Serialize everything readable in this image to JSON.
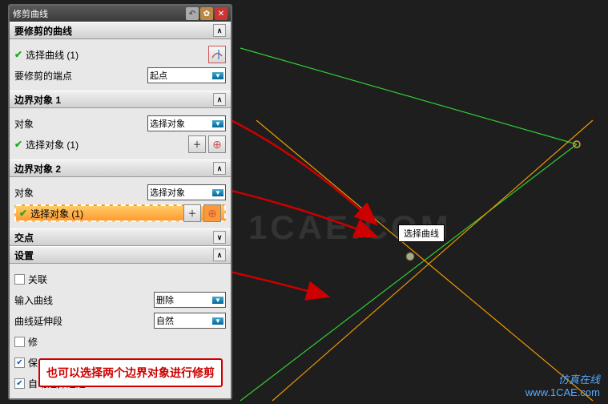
{
  "window": {
    "title": "修剪曲线"
  },
  "sections": {
    "curveToTrim": {
      "title": "要修剪的曲线",
      "selectCurve": "选择曲线 (1)",
      "endpointLabel": "要修剪的端点",
      "endpointValue": "起点"
    },
    "boundary1": {
      "title": "边界对象 1",
      "objectLabel": "对象",
      "objectValue": "选择对象",
      "selectObject": "选择对象 (1)"
    },
    "boundary2": {
      "title": "边界对象 2",
      "objectLabel": "对象",
      "objectValue": "选择对象",
      "selectObject": "选择对象 (1)"
    },
    "intersection": {
      "title": "交点"
    },
    "settings": {
      "title": "设置",
      "assoc": "关联",
      "inputCurveLabel": "输入曲线",
      "inputCurveValue": "删除",
      "extendLabel": "曲线延伸段",
      "extendValue": "自然",
      "repair": "修",
      "keep": "保",
      "autoSelect": "自动选择递进"
    }
  },
  "tooltip": "选择曲线",
  "callout": "也可以选择两个边界对象进行修剪",
  "watermark": {
    "brand": "仿真在线",
    "url": "www.1CAE.com"
  },
  "bgmark": "1CAE.COM"
}
